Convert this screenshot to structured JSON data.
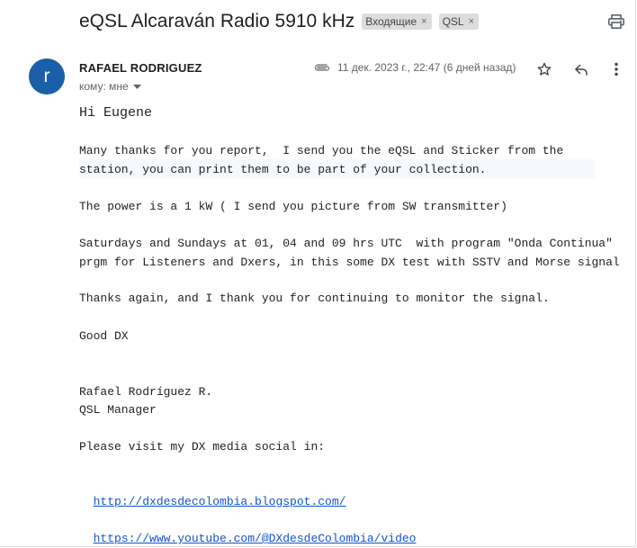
{
  "email": {
    "subject": "eQSL Alcaraván Radio 5910 kHz",
    "labels": [
      {
        "text": "Входящие",
        "remove": "×"
      },
      {
        "text": "QSL",
        "remove": "×"
      }
    ],
    "sender": {
      "avatar_letter": "r",
      "avatar_color": "#1a5fa8",
      "name": "RAFAEL RODRIGUEZ",
      "recipient": "кому: мне"
    },
    "date": "11 дек. 2023 г., 22:47 (6 дней назад)",
    "body": {
      "greeting": "Hi Eugene",
      "p1_l1": "Many thanks for you report,  I send you the eQSL and Sticker from the",
      "p1_l2": "station, you can print them to be part of your collection.",
      "p2": "The power is a 1 kW ( I send you picture from SW transmitter)",
      "p3_l1": "Saturdays and Sundays at 01, 04 and 09 hrs UTC  with program \"Onda Continua\"",
      "p3_l2": "prgm for Listeners and Dxers, in this some DX test with SSTV and Morse signal",
      "p4": "Thanks again, and I thank you for continuing to monitor the signal.",
      "p5": "Good DX",
      "sig_name": "Rafael Rodríguez R.",
      "sig_title": "QSL Manager",
      "p6": "Please visit my DX media social in:",
      "link1": "http://dxdesdecolombia.blogspot.com/",
      "link2": "https://www.youtube.com/@DXdesdeColombia/video"
    }
  },
  "icons": {
    "print": "printer-icon",
    "attachment": "paperclip-icon",
    "star": "star-icon",
    "reply": "reply-icon",
    "more": "more-vert-icon",
    "caret": "caret-down-icon"
  },
  "colors": {
    "link": "#1155cc",
    "chip_bg": "#dddddd"
  }
}
